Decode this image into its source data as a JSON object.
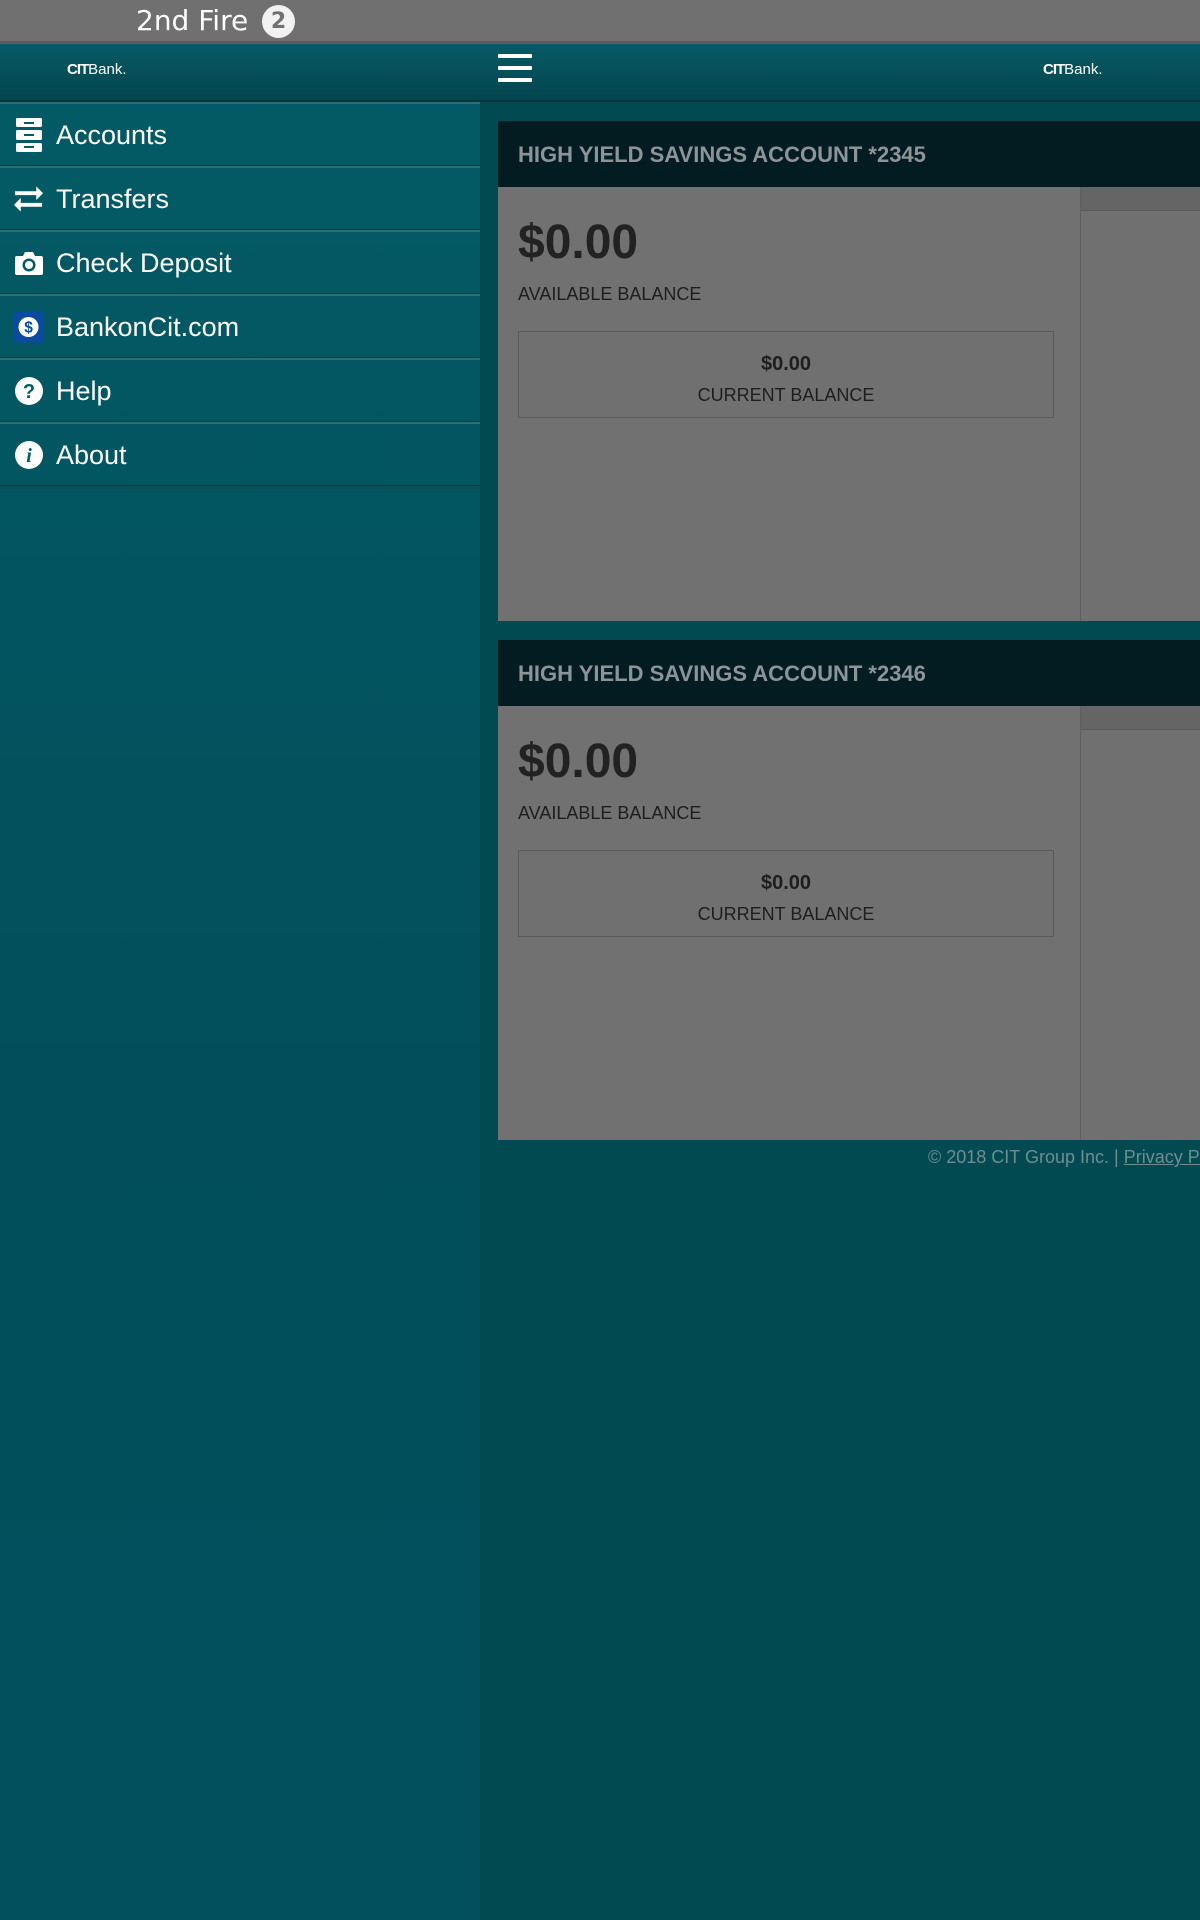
{
  "statusbar": {
    "title": "2nd Fire",
    "badge": "2"
  },
  "brand": {
    "logo_mark": "CIT",
    "logo_word": "Bank."
  },
  "drawer": {
    "items": [
      {
        "label": "Accounts",
        "icon": "accounts-icon"
      },
      {
        "label": "Transfers",
        "icon": "transfer-icon"
      },
      {
        "label": "Check Deposit",
        "icon": "camera-icon"
      },
      {
        "label": "BankonCit.com",
        "icon": "dollar-icon"
      },
      {
        "label": "Help",
        "icon": "help-icon"
      },
      {
        "label": "About",
        "icon": "info-icon"
      }
    ]
  },
  "accounts": [
    {
      "title": "HIGH YIELD SAVINGS ACCOUNT *2345",
      "available_balance": "$0.00",
      "available_label": "AVAILABLE BALANCE",
      "current_balance": "$0.00",
      "current_label": "CURRENT BALANCE"
    },
    {
      "title": "HIGH YIELD SAVINGS ACCOUNT *2346",
      "available_balance": "$0.00",
      "available_label": "AVAILABLE BALANCE",
      "current_balance": "$0.00",
      "current_label": "CURRENT BALANCE"
    }
  ],
  "footer": {
    "copyright": "© 2018 CIT Group Inc. | ",
    "privacy_link": "Privacy Po"
  },
  "colors": {
    "drawer_bg": "#035b66",
    "main_bg": "#024a52",
    "card_bg": "#707070",
    "card_header": "#021c22",
    "dollar_icon_bg": "#0a4aa0"
  }
}
